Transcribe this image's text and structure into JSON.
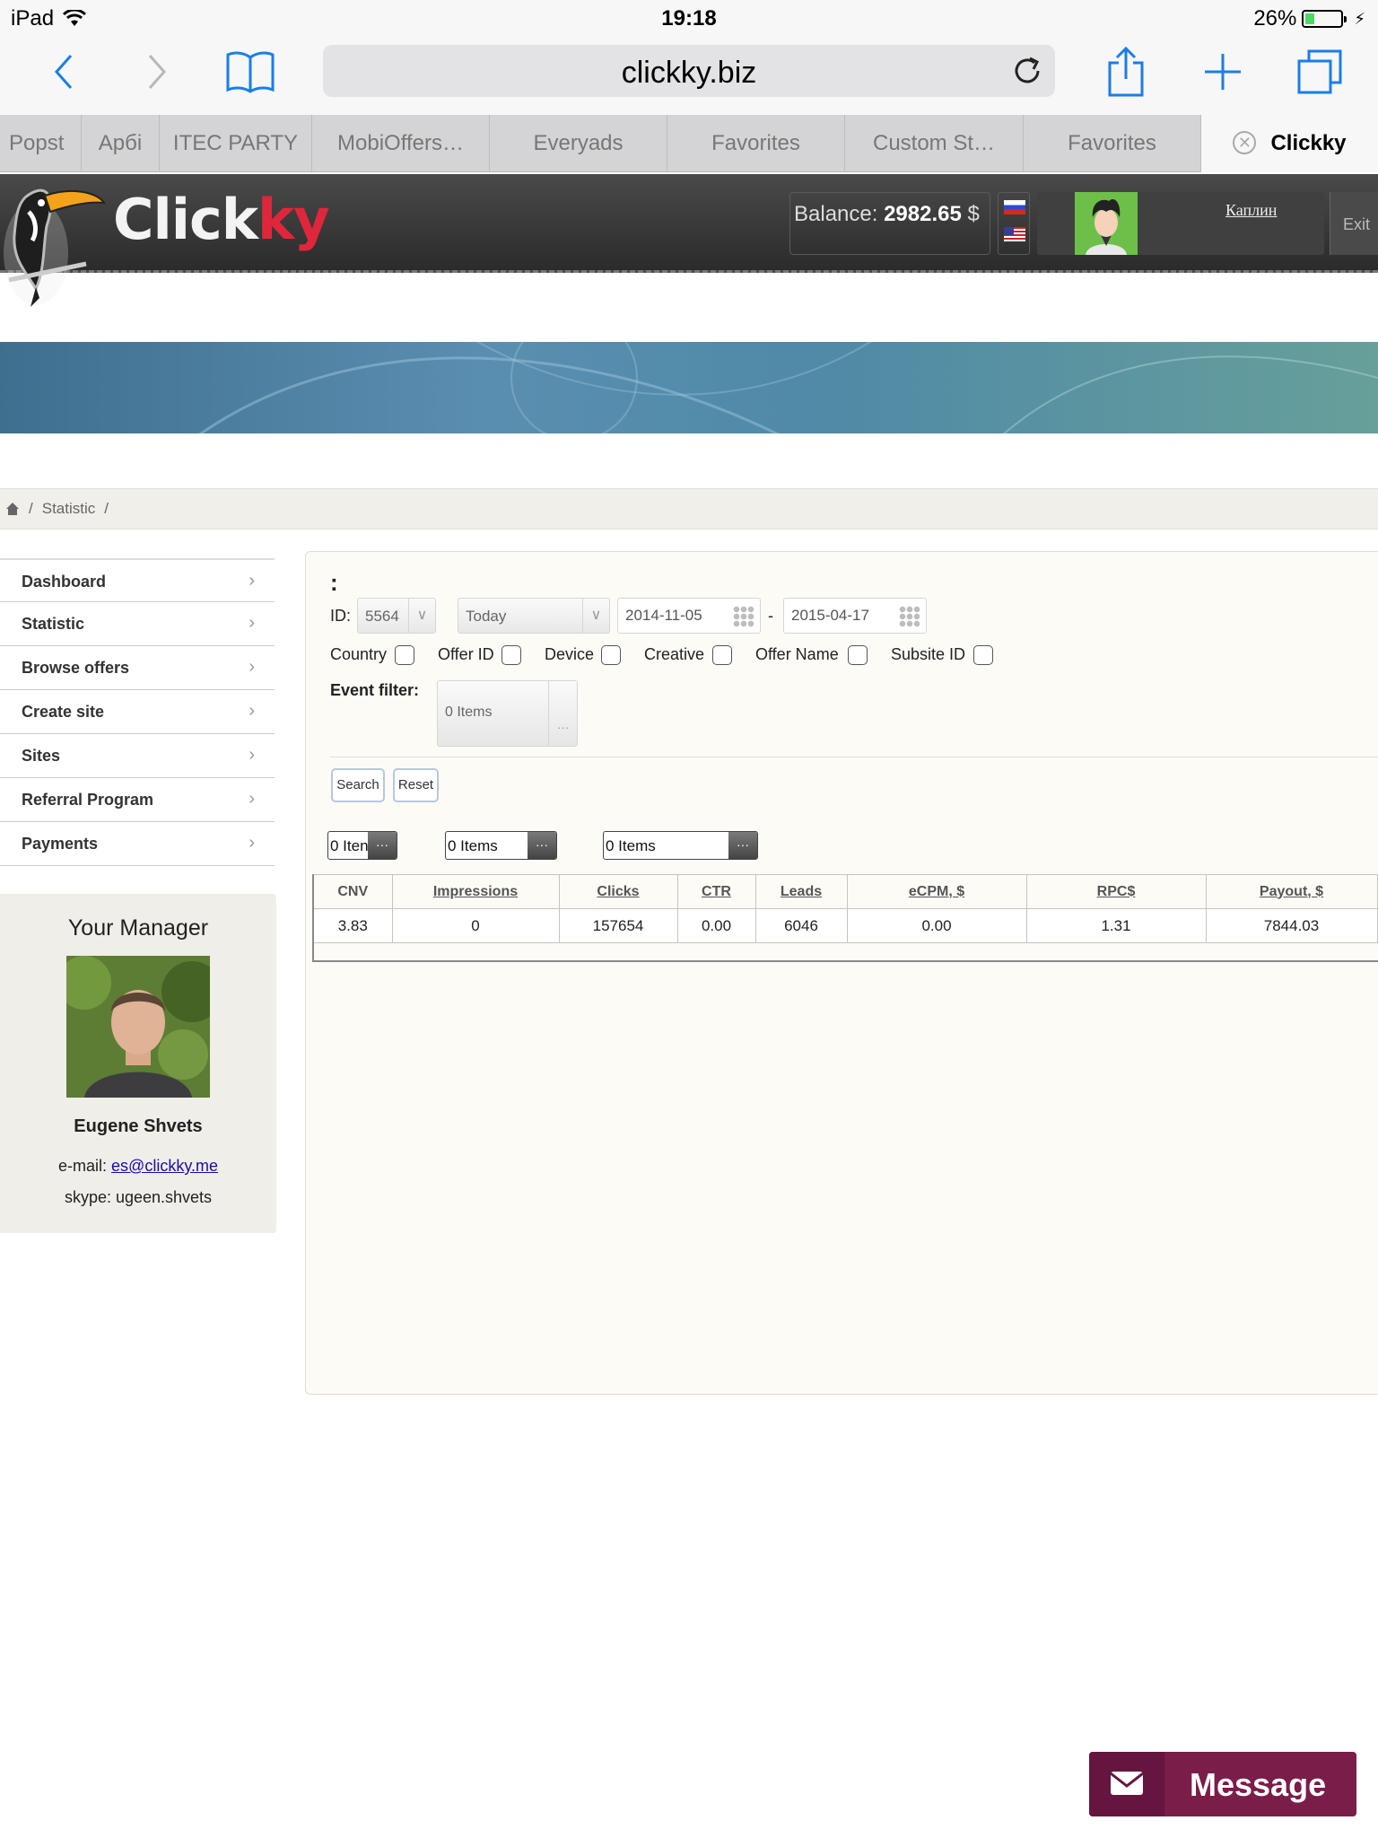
{
  "statusbar": {
    "device": "iPad",
    "time": "19:18",
    "battery": "26%"
  },
  "browser": {
    "url": "clickky.biz"
  },
  "favorites": [
    "Popst",
    "Арбі",
    "ITEC PARTY",
    "MobiOffers…",
    "Everyads",
    "Favorites",
    "Custom St…",
    "Favorites"
  ],
  "active_tab": "Clickky",
  "header": {
    "logo_click": "Click",
    "logo_ky": "ky",
    "balance_label": "Balance:",
    "balance_value": "2982.65",
    "balance_currency": "$",
    "username": "Каплин",
    "exit_label": "Exit"
  },
  "breadcrumb": {
    "current": "Statistic"
  },
  "sidebar": {
    "items": [
      "Dashboard",
      "Statistic",
      "Browse offers",
      "Create site",
      "Sites",
      "Referral Program",
      "Payments"
    ]
  },
  "manager": {
    "title": "Your Manager",
    "name": "Eugene Shvets",
    "email_label": "e-mail:",
    "email": "es@clickky.me",
    "skype": "skype: ugeen.shvets"
  },
  "filters": {
    "colon": ":",
    "id_label": "ID:",
    "id_value": "5564",
    "period": "Today",
    "date_from": "2014-11-05",
    "date_sep": "-",
    "date_to": "2015-04-17",
    "checkboxes": [
      "Country",
      "Offer ID",
      "Device",
      "Creative",
      "Offer Name",
      "Subsite ID"
    ],
    "event_filter_label": "Event filter:",
    "event_filter_value": "0 Items",
    "search_button": "Search",
    "reset_button": "Reset",
    "multi1": "0 Iten",
    "multi2": "0 Items",
    "multi3": "0 Items"
  },
  "table": {
    "headers": [
      "CNV",
      "Impressions",
      "Clicks",
      "CTR",
      "Leads",
      "eCPM, $",
      "RPC$",
      "Payout, $"
    ],
    "rows": [
      [
        "3.83",
        "0",
        "157654",
        "0.00",
        "6046",
        "0.00",
        "1.31",
        "7844.03"
      ]
    ]
  },
  "message_widget": {
    "label": "Message"
  },
  "colors": {
    "brand_red": "#e0263a",
    "header_dark": "#2b2b2b",
    "message_bg": "#7a1d49",
    "ios_blue": "#1a7ee8"
  }
}
